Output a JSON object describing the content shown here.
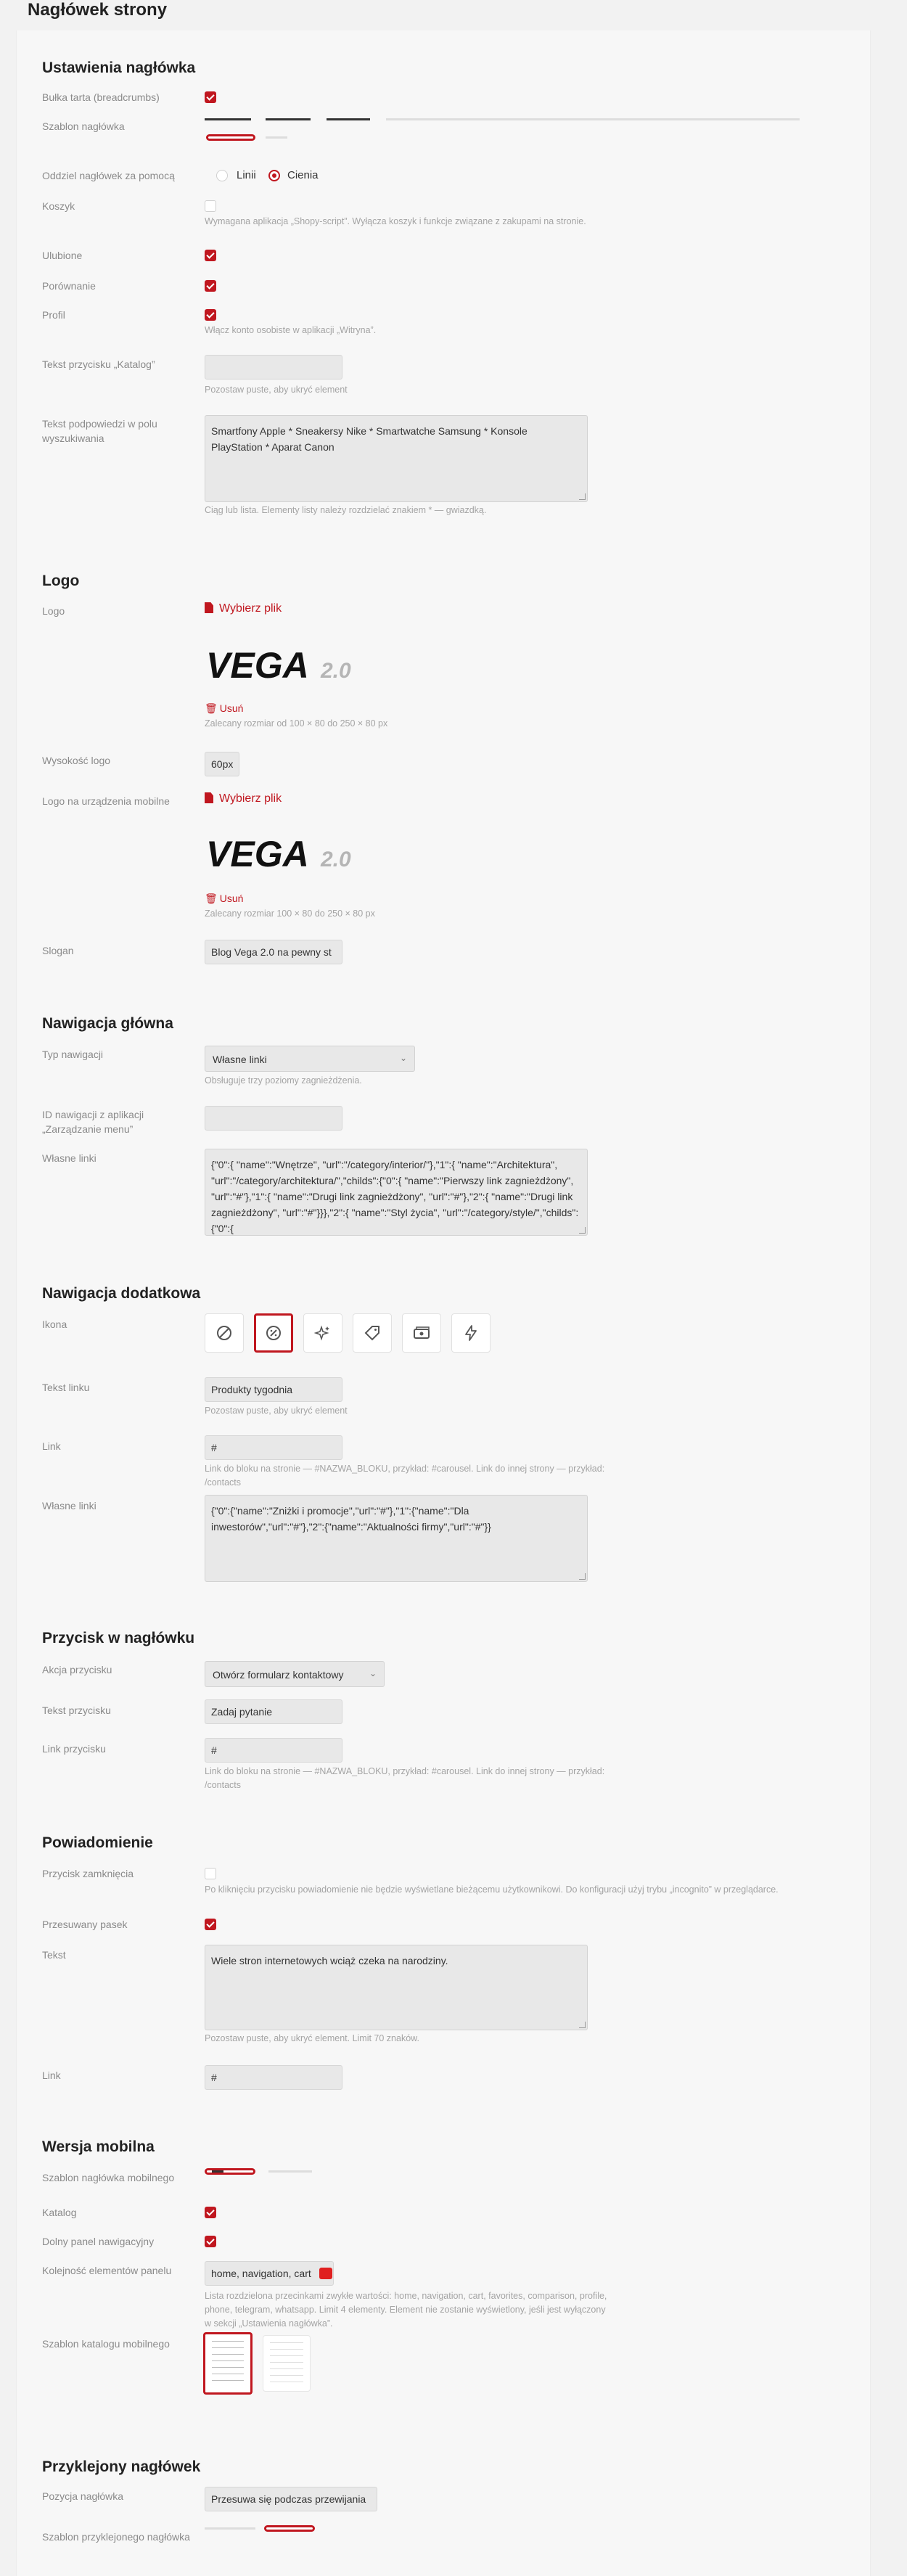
{
  "page": {
    "title": "Nagłówek strony"
  },
  "header_settings": {
    "title": "Ustawienia nagłówka",
    "breadcrumbs_label": "Bułka tarta (breadcrumbs)",
    "template_label": "Szablon nagłówka",
    "divider_label": "Oddziel nagłówek za pomocą",
    "divider_options": [
      "Linii",
      "Cienia"
    ],
    "divider_selected": "Cienia",
    "cart_label": "Koszyk",
    "cart_hint": "Wymagana aplikacja „Shopy-script”. Wyłącza koszyk i funkcje związane z zakupami na stronie.",
    "favorites_label": "Ulubione",
    "compare_label": "Porównanie",
    "profile_label": "Profil",
    "profile_hint": "Włącz konto osobiste w aplikacji „Witryna”.",
    "catalog_btn_label": "Tekst przycisku „Katalog”",
    "catalog_btn_hint": "Pozostaw puste, aby ukryć element",
    "search_label": "Tekst podpowiedzi w polu wyszukiwania",
    "search_value": "Smartfony Apple * Sneakersy Nike * Smartwatche Samsung * Konsole PlayStation * Aparat Canon",
    "search_hint": "Ciąg lub lista. Elementy listy należy rozdzielać znakiem * — gwiazdką."
  },
  "logo": {
    "title": "Logo",
    "logo_label": "Logo",
    "choose_file": "Wybierz plik",
    "remove": "Usuń",
    "size_hint": "Zalecany rozmiar od 100 × 80 do 250 × 80 px",
    "height_label": "Wysokość logo",
    "height_value": "60px",
    "mobile_label": "Logo na urządzenia mobilne",
    "mobile_size_hint": "Zalecany rozmiar 100 × 80 do 250 × 80 px",
    "slogan_label": "Slogan",
    "slogan_value": "Blog Vega 2.0 na pewny st",
    "logo_text_main": "VEGA",
    "logo_text_version": "2.0"
  },
  "main_nav": {
    "title": "Nawigacja główna",
    "type_label": "Typ nawigacji",
    "type_value": "Własne linki",
    "type_hint": "Obsługuje trzy poziomy zagnieżdżenia.",
    "app_id_label": "ID nawigacji z aplikacji „Zarządzanie menu”",
    "custom_links_label": "Własne linki",
    "custom_links_value": "{\"0\":{ \"name\":\"Wnętrze\", \"url\":\"/category/interior/\"},\"1\":{ \"name\":\"Architektura\", \"url\":\"/category/architektura/\",\"childs\":{\"0\":{ \"name\":\"Pierwszy link zagnieżdżony\", \"url\":\"#\"},\"1\":{ \"name\":\"Drugi link zagnieżdżony\", \"url\":\"#\"},\"2\":{ \"name\":\"Drugi link zagnieżdżony\", \"url\":\"#\"}}},\"2\":{ \"name\":\"Styl życia\", \"url\":\"/category/style/\",\"childs\":{\"0\":{"
  },
  "extra_nav": {
    "title": "Nawigacja dodatkowa",
    "icon_label": "Ikona",
    "icons": [
      "none-icon",
      "discount-badge-icon",
      "sparkles-icon",
      "tag-icon",
      "money-icon",
      "lightning-icon"
    ],
    "link_text_label": "Tekst linku",
    "link_text_value": "Produkty tygodnia",
    "link_text_hint": "Pozostaw puste, aby ukryć element",
    "link_label": "Link",
    "link_value": "#",
    "link_hint": "Link do bloku na stronie — #NAZWA_BLOKU, przykład: #carousel. Link do innej strony — przykład: /contacts",
    "custom_links_label": "Własne linki",
    "custom_links_value": "{\"0\":{\"name\":\"Zniżki i promocje\",\"url\":\"#\"},\"1\":{\"name\":\"Dla inwestorów\",\"url\":\"#\"},\"2\":{\"name\":\"Aktualności firmy\",\"url\":\"#\"}}"
  },
  "header_button": {
    "title": "Przycisk w nagłówku",
    "action_label": "Akcja przycisku",
    "action_value": "Otwórz formularz kontaktowy",
    "text_label": "Tekst przycisku",
    "text_value": "Zadaj pytanie",
    "link_label": "Link przycisku",
    "link_value": "#",
    "link_hint": "Link do bloku na stronie — #NAZWA_BLOKU, przykład: #carousel. Link do innej strony — przykład: /contacts"
  },
  "notification": {
    "title": "Powiadomienie",
    "close_label": "Przycisk zamknięcia",
    "close_hint": "Po kliknięciu przycisku powiadomienie nie będzie wyświetlane bieżącemu użytkownikowi. Do konfiguracji użyj trybu „incognito” w przeglądarce.",
    "scroll_label": "Przesuwany pasek",
    "text_label": "Tekst",
    "text_value": "Wiele stron internetowych wciąż czeka na narodziny.",
    "text_hint": "Pozostaw puste, aby ukryć element. Limit 70 znaków.",
    "link_label": "Link",
    "link_value": "#"
  },
  "mobile": {
    "title": "Wersja mobilna",
    "template_label": "Szablon nagłówka mobilnego",
    "catalog_label": "Katalog",
    "bottom_panel_label": "Dolny panel nawigacyjny",
    "order_label": "Kolejność elementów panelu",
    "order_value": "home, navigation, cart",
    "order_hint": "Lista rozdzielona przecinkami zwykłe wartości: home, navigation, cart, favorites, comparison, profile, phone, telegram, whatsapp. Limit 4 elementy. Element nie zostanie wyświetlony, jeśli jest wyłączony w sekcji „Ustawienia nagłówka”.",
    "catalog_template_label": "Szablon katalogu mobilnego"
  },
  "sticky": {
    "title": "Przyklejony nagłówek",
    "position_label": "Pozycja nagłówka",
    "position_value": "Przesuwa się podczas przewijania",
    "template_label": "Szablon przyklejonego nagłówka"
  },
  "colors": {
    "accent": "#c0171f",
    "background": "#f2f2f2",
    "input_bg": "#e8e8e8"
  }
}
